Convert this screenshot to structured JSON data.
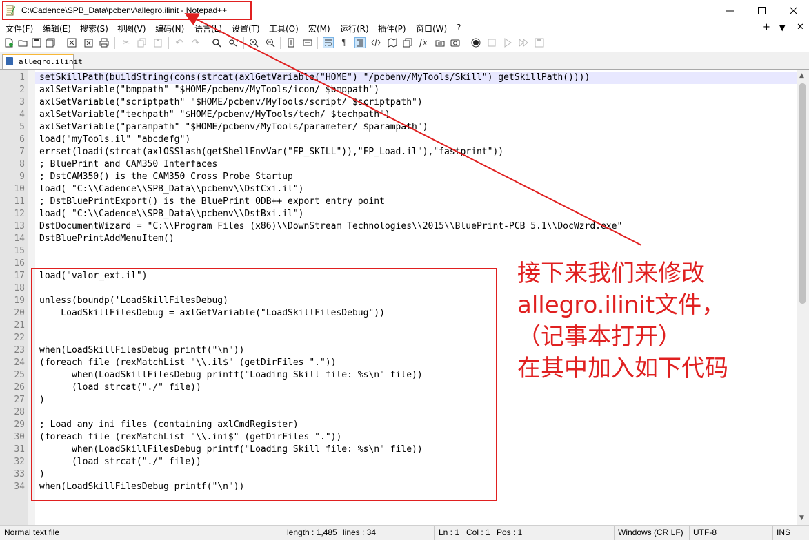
{
  "window": {
    "title": "C:\\Cadence\\SPB_Data\\pcbenv\\allegro.ilinit - Notepad++",
    "minimize_icon": "minimize-icon",
    "maximize_icon": "maximize-icon",
    "close_icon": "close-icon"
  },
  "menu": {
    "items": [
      "文件(F)",
      "编辑(E)",
      "搜索(S)",
      "视图(V)",
      "编码(N)",
      "语言(L)",
      "设置(T)",
      "工具(O)",
      "宏(M)",
      "运行(R)",
      "插件(P)",
      "窗口(W)",
      "?"
    ],
    "right": [
      "+",
      "▼",
      "✕"
    ]
  },
  "toolbar": {
    "icons": [
      "new-file-icon",
      "open-file-icon",
      "save-icon",
      "save-all-icon",
      "close-icon",
      "close-all-icon",
      "print-icon",
      "cut-icon",
      "copy-icon",
      "paste-icon",
      "undo-icon",
      "redo-icon",
      "find-icon",
      "replace-icon",
      "zoom-in-icon",
      "zoom-out-icon",
      "sync-vertical-icon",
      "sync-horizontal-icon",
      "word-wrap-icon",
      "show-all-chars-icon",
      "indent-guide-icon",
      "xml-tag-icon",
      "document-map-icon",
      "document-list-icon",
      "function-list-icon",
      "folder-as-workspace-icon",
      "monitoring-icon",
      "record-macro-icon",
      "stop-record-icon",
      "play-macro-icon",
      "run-macro-multiple-icon",
      "save-macro-icon"
    ]
  },
  "tab": {
    "label": "allegro.ilinit"
  },
  "editor": {
    "lines": [
      "setSkillPath(buildString(cons(strcat(axlGetVariable(\"HOME\") \"/pcbenv/MyTools/Skill\") getSkillPath())))",
      "axlSetVariable(\"bmppath\" \"$HOME/pcbenv/MyTools/icon/ $bmppath\")",
      "axlSetVariable(\"scriptpath\" \"$HOME/pcbenv/MyTools/script/ $scriptpath\")",
      "axlSetVariable(\"techpath\" \"$HOME/pcbenv/MyTools/tech/ $techpath\")",
      "axlSetVariable(\"parampath\" \"$HOME/pcbenv/MyTools/parameter/ $parampath\")",
      "load(\"myTools.il\" \"abcdefg\")",
      "errset(loadi(strcat(axlOSSlash(getShellEnvVar(\"FP_SKILL\")),\"FP_Load.il\"),\"fastprint\"))",
      "; BluePrint and CAM350 Interfaces",
      "; DstCAM350() is the CAM350 Cross Probe Startup",
      "load( \"C:\\\\Cadence\\\\SPB_Data\\\\pcbenv\\\\DstCxi.il\")",
      "; DstBluePrintExport() is the BluePrint ODB++ export entry point",
      "load( \"C:\\\\Cadence\\\\SPB_Data\\\\pcbenv\\\\DstBxi.il\")",
      "DstDocumentWizard = \"C:\\\\Program Files (x86)\\\\DownStream Technologies\\\\2015\\\\BluePrint-PCB 5.1\\\\DocWzrd.exe\"",
      "DstBluePrintAddMenuItem()",
      "",
      "",
      "load(\"valor_ext.il\")",
      "",
      "unless(boundp('LoadSkillFilesDebug)",
      "    LoadSkillFilesDebug = axlGetVariable(\"LoadSkillFilesDebug\"))",
      "",
      "",
      "when(LoadSkillFilesDebug printf(\"\\n\"))",
      "(foreach file (rexMatchList \"\\\\.il$\" (getDirFiles \".\"))",
      "      when(LoadSkillFilesDebug printf(\"Loading Skill file: %s\\n\" file))",
      "      (load strcat(\"./\" file))",
      ")",
      "",
      "; Load any ini files (containing axlCmdRegister)",
      "(foreach file (rexMatchList \"\\\\.ini$\" (getDirFiles \".\"))",
      "      when(LoadSkillFilesDebug printf(\"Loading Skill file: %s\\n\" file))",
      "      (load strcat(\"./\" file))",
      ")",
      "when(LoadSkillFilesDebug printf(\"\\n\"))"
    ]
  },
  "annotation": {
    "lines": [
      "接下来我们来修改",
      "allegro.ilinit文件，",
      "（记事本打开）",
      "在其中加入如下代码"
    ],
    "color": "#e02020"
  },
  "status": {
    "type": "Normal text file",
    "length": "length : 1,485",
    "lines": "lines : 34",
    "ln": "Ln : 1",
    "col": "Col : 1",
    "pos": "Pos : 1",
    "eol": "Windows (CR LF)",
    "encoding": "UTF-8",
    "mode": "INS"
  }
}
